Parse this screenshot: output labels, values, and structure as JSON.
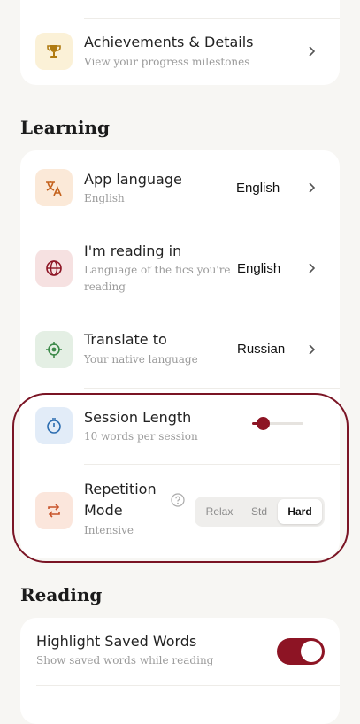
{
  "colors": {
    "background": "#f7f6f3",
    "accent": "#8d1424",
    "highlight_ring": "#7a1424"
  },
  "progress_card": {
    "achievements": {
      "title": "Achievements & Details",
      "subtitle": "View your progress milestones",
      "icon": "trophy-icon"
    }
  },
  "learning": {
    "heading": "Learning",
    "app_language": {
      "title": "App language",
      "subtitle": "English",
      "value": "English",
      "icon": "translate-icon"
    },
    "reading_in": {
      "title": "I'm reading in",
      "subtitle": "Language of the fics you're reading",
      "value": "English",
      "icon": "globe-icon"
    },
    "translate_to": {
      "title": "Translate to",
      "subtitle": "Your native language",
      "value": "Russian",
      "icon": "target-icon"
    },
    "session_length": {
      "title": "Session Length",
      "subtitle": "10 words per session",
      "slider_fraction": 0.2,
      "icon": "timer-icon"
    },
    "repetition_mode": {
      "title_line1": "Repetition",
      "title_line2": "Mode",
      "subtitle": "Intensive",
      "icon": "repeat-icon",
      "help_icon": "help-circle-icon",
      "options": [
        "Relax",
        "Std",
        "Hard"
      ],
      "selected": "Hard"
    }
  },
  "reading": {
    "heading": "Reading",
    "highlight_saved_words": {
      "title": "Highlight Saved Words",
      "subtitle": "Show saved words while reading",
      "enabled": true
    }
  }
}
